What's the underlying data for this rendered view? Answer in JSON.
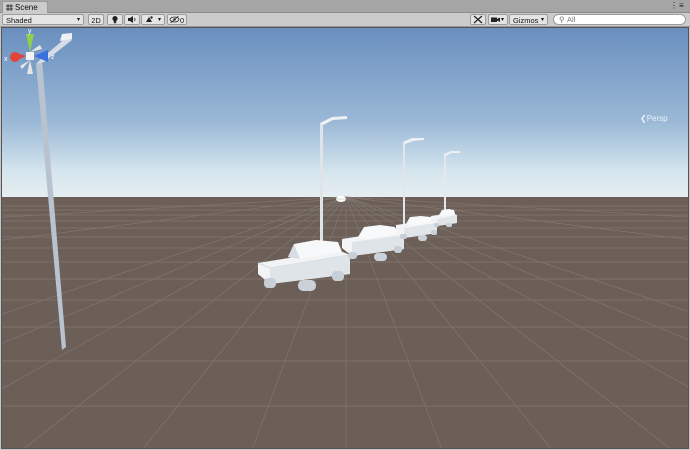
{
  "window": {
    "tab_label": "Scene"
  },
  "toolbar": {
    "draw_mode": "Shaded",
    "mode_2d": "2D",
    "hidden_count": "0",
    "gizmos_label": "Gizmos",
    "search_placeholder": "All"
  },
  "scene_gizmo": {
    "projection_label": "Persp",
    "axis_x": "x",
    "axis_y": "y",
    "axis_z": "z"
  },
  "colors": {
    "sky_top": "#6a8fbf",
    "horizon": "#dbe8ee",
    "ground": "#6b5f58",
    "grid": "#8a7f78",
    "axis_x": "#e0453a",
    "axis_y": "#8fd14f",
    "axis_z": "#3a6fe0"
  }
}
